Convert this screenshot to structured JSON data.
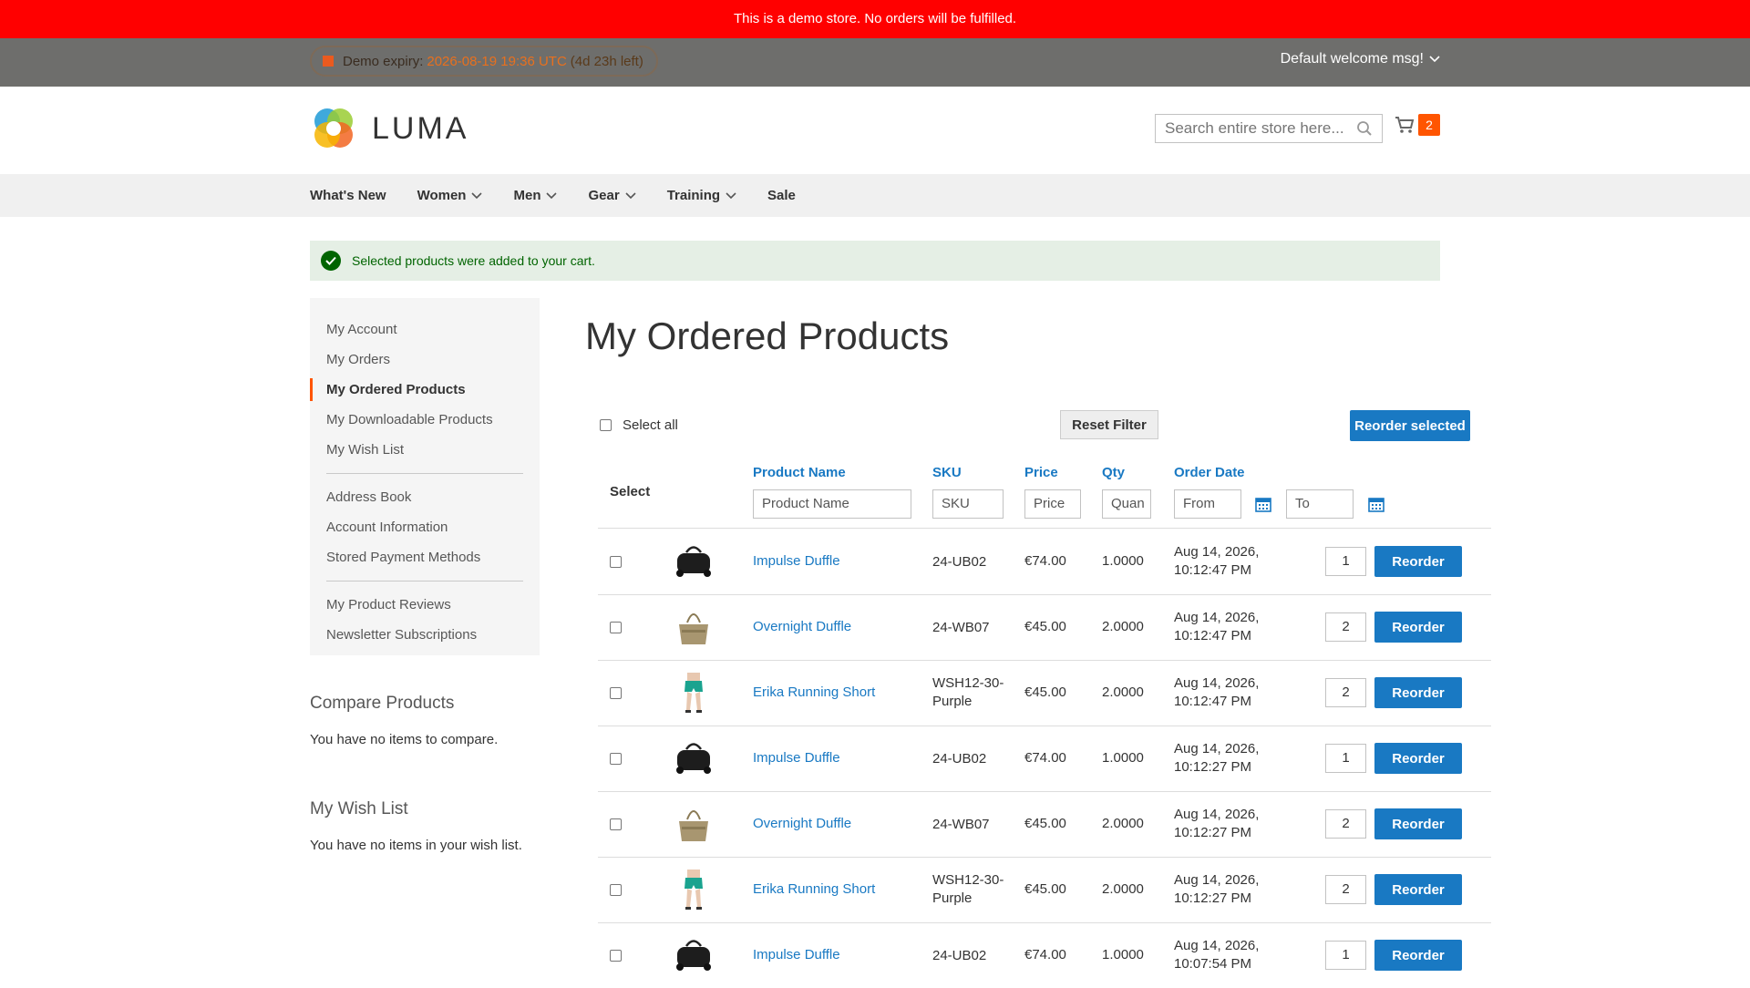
{
  "demo_notice": "This is a demo store. No orders will be fulfilled.",
  "panel": {
    "expiry_label": "Demo expiry:",
    "expiry_date": "2026-08-19 19:36 UTC",
    "expiry_left": "(4d 23h left)",
    "welcome": "Default welcome msg!"
  },
  "header": {
    "logo_text": "LUMA",
    "search_placeholder": "Search entire store here...",
    "cart_count": "2"
  },
  "nav": [
    "What's New",
    "Women",
    "Men",
    "Gear",
    "Training",
    "Sale"
  ],
  "message": "Selected products were added to your cart.",
  "sidebar": {
    "group1": [
      "My Account",
      "My Orders",
      "My Ordered Products",
      "My Downloadable Products",
      "My Wish List"
    ],
    "group2": [
      "Address Book",
      "Account Information",
      "Stored Payment Methods"
    ],
    "group3": [
      "My Product Reviews",
      "Newsletter Subscriptions"
    ],
    "current": "My Ordered Products"
  },
  "compare": {
    "title": "Compare Products",
    "empty": "You have no items to compare."
  },
  "wishlist": {
    "title": "My Wish List",
    "empty": "You have no items in your wish list."
  },
  "page_title": "My Ordered Products",
  "toolbar": {
    "select_all": "Select all",
    "reset_filter": "Reset Filter",
    "reorder_selected": "Reorder selected"
  },
  "table": {
    "select_header": "Select",
    "headers": {
      "name": "Product Name",
      "sku": "SKU",
      "price": "Price",
      "qty": "Qty",
      "date": "Order Date"
    },
    "filters": {
      "name": "Product Name",
      "sku": "SKU",
      "price": "Price",
      "qty": "Quan",
      "from": "From",
      "to": "To"
    },
    "reorder_label": "Reorder",
    "rows": [
      {
        "name": "Impulse Duffle",
        "sku": "24-UB02",
        "price": "€74.00",
        "qty": "1.0000",
        "date1": "Aug 14, 2026,",
        "date2": "10:12:47 PM",
        "qty_input": "1",
        "thumb": "black-duffle"
      },
      {
        "name": "Overnight Duffle",
        "sku": "24-WB07",
        "price": "€45.00",
        "qty": "2.0000",
        "date1": "Aug 14, 2026,",
        "date2": "10:12:47 PM",
        "qty_input": "2",
        "thumb": "tan-bag"
      },
      {
        "name": "Erika Running Short",
        "sku": "WSH12-30-",
        "sku2": "Purple",
        "price": "€45.00",
        "qty": "2.0000",
        "date1": "Aug 14, 2026,",
        "date2": "10:12:47 PM",
        "qty_input": "2",
        "thumb": "short"
      },
      {
        "name": "Impulse Duffle",
        "sku": "24-UB02",
        "price": "€74.00",
        "qty": "1.0000",
        "date1": "Aug 14, 2026,",
        "date2": "10:12:27 PM",
        "qty_input": "1",
        "thumb": "black-duffle"
      },
      {
        "name": "Overnight Duffle",
        "sku": "24-WB07",
        "price": "€45.00",
        "qty": "2.0000",
        "date1": "Aug 14, 2026,",
        "date2": "10:12:27 PM",
        "qty_input": "2",
        "thumb": "tan-bag"
      },
      {
        "name": "Erika Running Short",
        "sku": "WSH12-30-",
        "sku2": "Purple",
        "price": "€45.00",
        "qty": "2.0000",
        "date1": "Aug 14, 2026,",
        "date2": "10:12:27 PM",
        "qty_input": "2",
        "thumb": "short"
      },
      {
        "name": "Impulse Duffle",
        "sku": "24-UB02",
        "price": "€74.00",
        "qty": "1.0000",
        "date1": "Aug 14, 2026,",
        "date2": "10:07:54 PM",
        "qty_input": "1",
        "thumb": "black-duffle"
      }
    ]
  },
  "colors": {
    "accent": "#1979c3",
    "demo_bar": "#ff0000",
    "badge": "#ff5501",
    "success": "#006400"
  }
}
